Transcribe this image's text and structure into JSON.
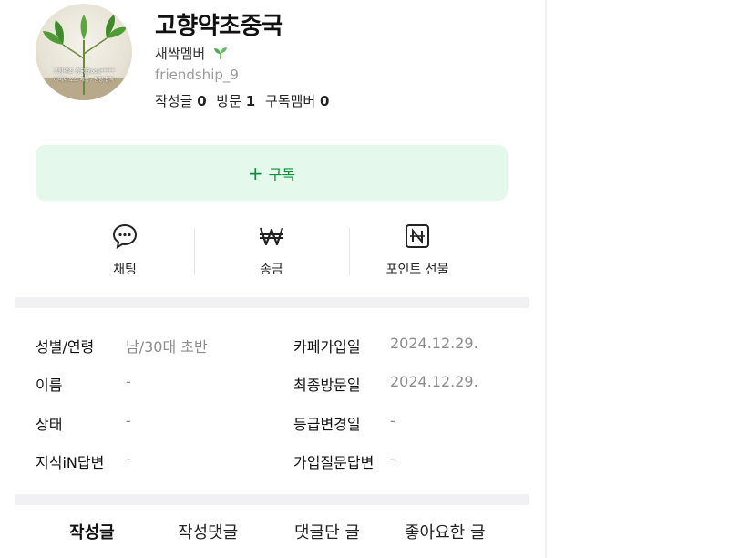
{
  "profile": {
    "cafe_name": "고향약초중국",
    "grade": "새싹멤버",
    "grade_icon": "sprout-icon",
    "member_id": "friendship_9",
    "avatar_caption_line1": "고향약초 중국@ooe*****",
    "avatar_caption_line2": "이미지 소스 제공 · 평양 합작",
    "stats": [
      {
        "label": "작성글",
        "value": "0"
      },
      {
        "label": "방문",
        "value": "1"
      },
      {
        "label": "구독멤버",
        "value": "0"
      }
    ]
  },
  "subscribe": {
    "icon": "plus-icon",
    "label": "구독",
    "color": "#0a8f3e",
    "bg": "#e5f8ec"
  },
  "actions": [
    {
      "icon": "chat-bubble-icon",
      "label": "채팅"
    },
    {
      "icon": "won-icon",
      "label": "송금"
    },
    {
      "icon": "naver-point-icon",
      "label": "포인트 선물"
    }
  ],
  "info": {
    "left": [
      {
        "label": "성별/연령",
        "value": "남/30대 초반"
      },
      {
        "label": "이름",
        "value": "-"
      },
      {
        "label": "상태",
        "value": "-"
      },
      {
        "label": "지식iN답변",
        "value": "-"
      }
    ],
    "right": [
      {
        "label": "카페가입일",
        "value": "2024.12.29."
      },
      {
        "label": "최종방문일",
        "value": "2024.12.29."
      },
      {
        "label": "등급변경일",
        "value": "-"
      },
      {
        "label": "가입질문답변",
        "value": "-"
      }
    ]
  },
  "tabs": [
    {
      "label": "작성글",
      "active": true
    },
    {
      "label": "작성댓글",
      "active": false
    },
    {
      "label": "댓글단 글",
      "active": false
    },
    {
      "label": "좋아요한 글",
      "active": false
    }
  ]
}
